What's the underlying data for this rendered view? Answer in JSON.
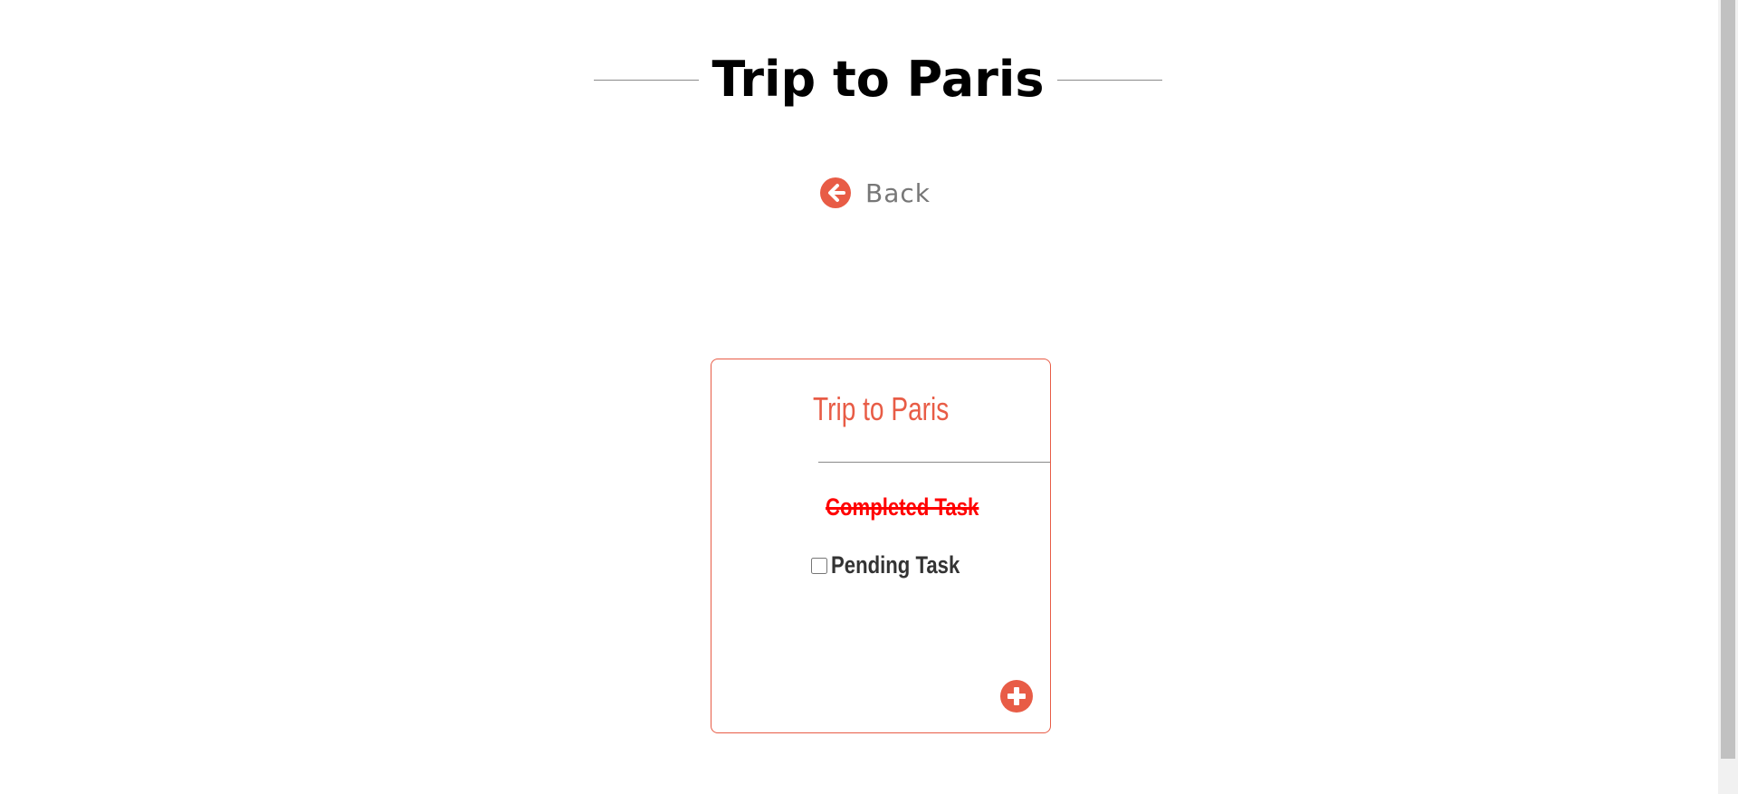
{
  "header": {
    "title": "Trip to Paris"
  },
  "navigation": {
    "back_label": "Back",
    "back_icon": "arrow-circle-left-icon"
  },
  "card": {
    "title": "Trip to Paris",
    "tasks": [
      {
        "label": "Completed Task",
        "completed": true
      },
      {
        "label": "Pending Task",
        "completed": false
      }
    ],
    "add_icon": "plus-circle-icon"
  },
  "colors": {
    "accent": "#e85c46",
    "completed_task": "#ff0000",
    "pending_task": "#333333",
    "title": "#000000",
    "back_label": "#777777"
  }
}
